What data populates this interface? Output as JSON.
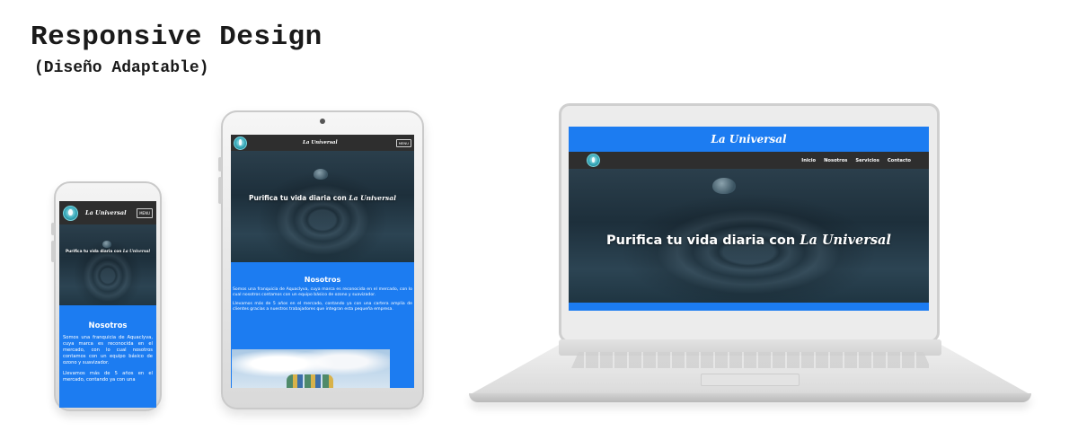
{
  "page": {
    "title": "Responsive Design",
    "subtitle": "(Diseño Adaptable)"
  },
  "site": {
    "brand": "La Universal",
    "menu_button": "MENU",
    "nav_links": [
      "Inicio",
      "Nosotros",
      "Servicios",
      "Contacto"
    ],
    "hero_prefix": "Purifica tu vida diaria con",
    "hero_brand": "La Universal",
    "section_title": "Nosotros",
    "paragraph_1": "Somos una franquicia de Aquaclyva, cuya marca es reconocida en el mercado, con lo cual nosotros contamos con un equipo básico de ozono y suavizador.",
    "paragraph_2": "Llevamos más de 5 años en el mercado, contando ya con una cartera amplia de clientes gracias a nuestros trabajadores que integran esta pequeña empresa.",
    "phone_paragraph_2_partial": "Llevamos más de 5 años en el mercado, contando ya con una"
  },
  "colors": {
    "accent_blue": "#1c7cf1",
    "navbar": "#2e2e2e",
    "water": "#24394a"
  },
  "icons": [
    "logo-drop-icon"
  ]
}
